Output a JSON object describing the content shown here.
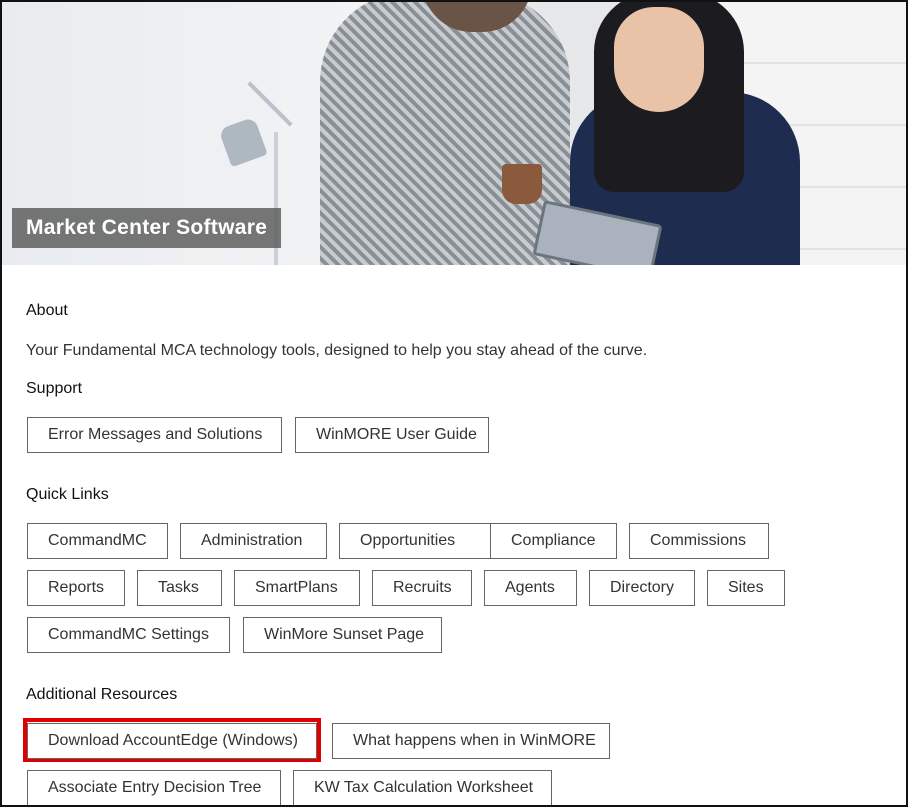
{
  "hero": {
    "title": "Market Center Software"
  },
  "about": {
    "heading": "About",
    "text": "Your Fundamental MCA technology tools, designed to help you stay ahead of the curve."
  },
  "support": {
    "heading": "Support",
    "buttons": [
      "Error Messages and Solutions",
      "WinMORE User Guide"
    ]
  },
  "quick_links": {
    "heading": "Quick Links",
    "buttons": [
      "CommandMC",
      "Administration",
      "Opportunities",
      "Compliance",
      "Commissions",
      "Reports",
      "Tasks",
      "SmartPlans",
      "Recruits",
      "Agents",
      "Directory",
      "Sites",
      "CommandMC Settings",
      "WinMore Sunset Page"
    ]
  },
  "additional_resources": {
    "heading": "Additional Resources",
    "buttons": [
      "Download AccountEdge (Windows)",
      "What happens when in WinMORE",
      "Associate Entry Decision Tree",
      "KW Tax Calculation Worksheet"
    ]
  },
  "colors": {
    "highlight": "#e00000",
    "title_bg": "#5f5f5f"
  }
}
